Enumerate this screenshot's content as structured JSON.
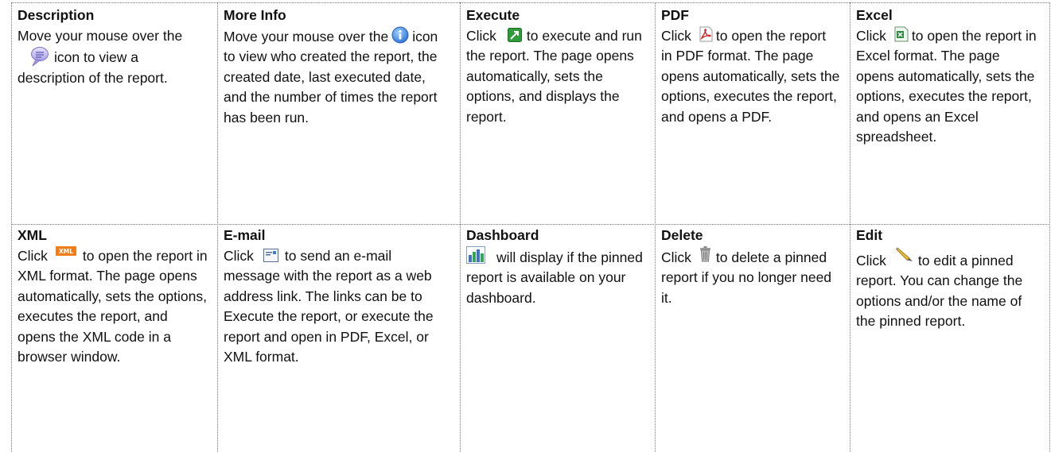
{
  "rows": [
    [
      {
        "title": "Description",
        "before": "Move your mouse over the",
        "icon": "speech-bubble-icon",
        "after": "icon to view a description of the report."
      },
      {
        "title": "More Info",
        "before": "Move your mouse over the",
        "icon": "info-icon",
        "after": "icon to view who created the report, the created date, last executed date, and the number of times the report has been run."
      },
      {
        "title": "Execute",
        "before": "Click",
        "icon": "execute-icon",
        "after": "to execute and run the report. The page opens automatically, sets the options, and displays the report."
      },
      {
        "title": "PDF",
        "before": "Click",
        "icon": "pdf-icon",
        "after": "to open the report in PDF format. The page opens automatically, sets the options, executes the report, and opens a PDF."
      },
      {
        "title": "Excel",
        "before": "Click",
        "icon": "excel-icon",
        "after": "to open the report in Excel format. The page opens automatically, sets the options, executes the report, and opens an Excel spreadsheet."
      }
    ],
    [
      {
        "title": "XML",
        "before": "Click",
        "icon": "xml-icon",
        "after": "to open the report in XML format. The page opens automatically, sets the options, executes the report, and opens the XML code in a browser window."
      },
      {
        "title": "E-mail",
        "before": "Click",
        "icon": "email-icon",
        "after": "to send an e-mail message with the report as a web address link. The links can be to Execute the report, or execute the report and open in PDF, Excel, or XML format."
      },
      {
        "title": "Dashboard",
        "before": "",
        "icon": "dashboard-chart-icon",
        "after": "will display if the pinned report is available on your dashboard."
      },
      {
        "title": "Delete",
        "before": "Click",
        "icon": "trash-icon",
        "after": "to delete a pinned report if you no longer need it."
      },
      {
        "title": "Edit",
        "before": "Click",
        "icon": "pencil-icon",
        "after": "to edit a pinned report. You can change the options and/or the name of the pinned report."
      }
    ]
  ]
}
